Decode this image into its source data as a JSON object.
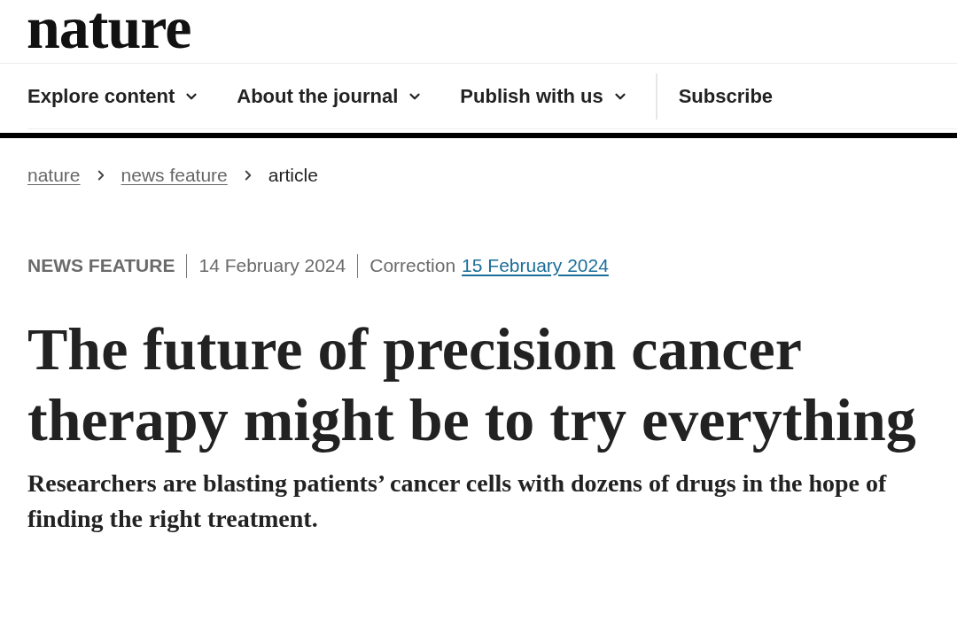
{
  "logo": "nature",
  "nav": [
    {
      "label": "Explore content",
      "kind": "menu"
    },
    {
      "label": "About the journal",
      "kind": "menu"
    },
    {
      "label": "Publish with us",
      "kind": "menu"
    },
    {
      "label": "Subscribe",
      "kind": "link"
    }
  ],
  "breadcrumb": [
    {
      "label": "nature",
      "kind": "link"
    },
    {
      "label": "news feature",
      "kind": "link"
    },
    {
      "label": "article",
      "kind": "current"
    }
  ],
  "meta": {
    "article_type": "NEWS FEATURE",
    "published": "14 February 2024",
    "correction_label": "Correction",
    "correction_date": "15 February 2024"
  },
  "title": "The future of precision cancer therapy might be to try everything",
  "standfirst": "Researchers are blasting patients’ cancer cells with dozens of drugs in the hope of finding the right treatment."
}
